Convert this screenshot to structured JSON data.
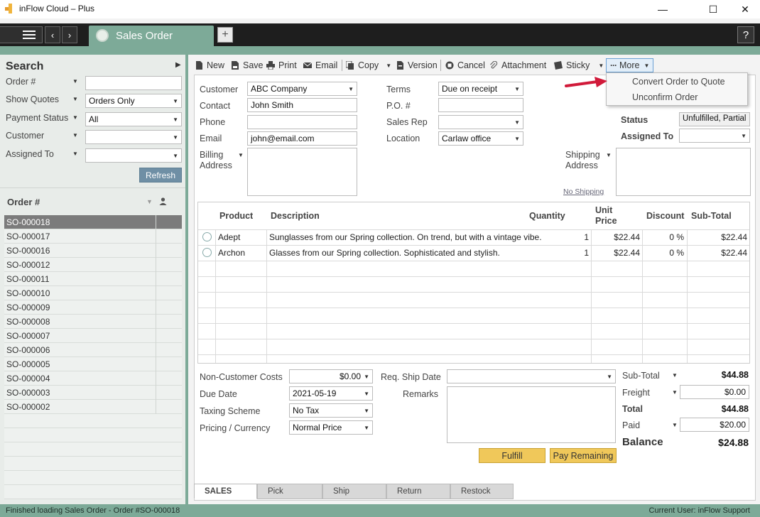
{
  "window": {
    "title": "inFlow Cloud – Plus",
    "minimize": "—",
    "maximize": "☐",
    "close": "✕"
  },
  "nav": {
    "tab_label": "Sales Order",
    "add": "+",
    "help": "?"
  },
  "search": {
    "title": "Search",
    "fields": [
      {
        "label": "Order #",
        "value": ""
      },
      {
        "label": "Show Quotes",
        "value": "Orders Only"
      },
      {
        "label": "Payment Status",
        "value": "All"
      },
      {
        "label": "Customer",
        "value": ""
      },
      {
        "label": "Assigned To",
        "value": ""
      }
    ],
    "refresh": "Refresh"
  },
  "orders": {
    "header": "Order #",
    "items": [
      "SO-000018",
      "SO-000017",
      "SO-000016",
      "SO-000012",
      "SO-000011",
      "SO-000010",
      "SO-000009",
      "SO-000008",
      "SO-000007",
      "SO-000006",
      "SO-000005",
      "SO-000004",
      "SO-000003",
      "SO-000002"
    ]
  },
  "toolbar": {
    "new": "New",
    "save": "Save",
    "print": "Print",
    "email": "Email",
    "copy": "Copy",
    "version": "Version",
    "cancel": "Cancel",
    "attachment": "Attachment",
    "sticky": "Sticky",
    "more": "More"
  },
  "more_menu": {
    "convert": "Convert Order to Quote",
    "unconfirm": "Unconfirm Order"
  },
  "order": {
    "customer_label": "Customer",
    "customer": "ABC Company",
    "contact_label": "Contact",
    "contact": "John Smith",
    "phone_label": "Phone",
    "phone": "",
    "email_label": "Email",
    "email": "john@email.com",
    "billing_label_1": "Billing",
    "billing_label_2": "Address",
    "terms_label": "Terms",
    "terms": "Due on receipt",
    "po_label": "P.O. #",
    "po": "",
    "salesrep_label": "Sales Rep",
    "salesrep": "",
    "location_label": "Location",
    "location": "Carlaw office",
    "status_label": "Status",
    "status": "Unfulfilled, Partial",
    "assigned_label": "Assigned To",
    "assigned": "",
    "shipping_label_1": "Shipping",
    "shipping_label_2": "Address",
    "no_shipping": "No Shipping"
  },
  "grid": {
    "headers": {
      "product": "Product",
      "description": "Description",
      "quantity": "Quantity",
      "unit_price_1": "Unit",
      "unit_price_2": "Price",
      "discount": "Discount",
      "subtotal": "Sub-Total"
    },
    "rows": [
      {
        "product": "Adept",
        "description": "Sunglasses from our Spring collection. On trend, but with a vintage vibe.",
        "quantity": "1",
        "unit_price": "$22.44",
        "discount": "0 %",
        "subtotal": "$22.44"
      },
      {
        "product": "Archon",
        "description": "Glasses from our Spring collection. Sophisticated and stylish.",
        "quantity": "1",
        "unit_price": "$22.44",
        "discount": "0 %",
        "subtotal": "$22.44"
      }
    ]
  },
  "lower": {
    "noncust_label": "Non-Customer Costs",
    "noncust": "$0.00",
    "duedate_label": "Due Date",
    "duedate": "2021-05-19",
    "taxing_label": "Taxing Scheme",
    "taxing": "No Tax",
    "pricing_label": "Pricing / Currency",
    "pricing": "Normal Price",
    "reqship_label": "Req. Ship Date",
    "reqship": "",
    "remarks_label": "Remarks"
  },
  "totals": {
    "subtotal_label": "Sub-Total",
    "subtotal": "$44.88",
    "freight_label": "Freight",
    "freight": "$0.00",
    "total_label": "Total",
    "total": "$44.88",
    "paid_label": "Paid",
    "paid": "$20.00",
    "balance_label": "Balance",
    "balance": "$24.88"
  },
  "actions": {
    "fulfill": "Fulfill",
    "pay_remaining": "Pay Remaining"
  },
  "bottom_tabs": [
    "SALES",
    "Pick",
    "Ship",
    "Return",
    "Restock"
  ],
  "status_bar": {
    "left": "Finished loading Sales Order - Order #SO-000018",
    "right": "Current User:  inFlow Support"
  },
  "colors": {
    "accent_green": "#7daa98",
    "nav_dark": "#1e1e1e",
    "button_yellow": "#f0c85a",
    "arrow_red": "#d11a3a"
  }
}
